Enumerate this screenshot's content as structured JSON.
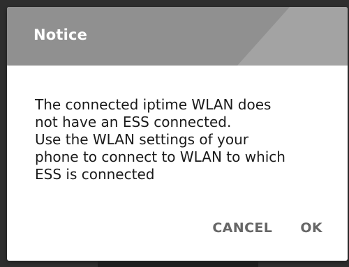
{
  "dialog": {
    "title": "Notice",
    "message": "The connected iptime WLAN does\nnot have an ESS connected.\n Use the WLAN settings of your\nphone to connect to WLAN to which\nESS is connected",
    "actions": {
      "cancel_label": "CANCEL",
      "ok_label": "OK"
    }
  },
  "colors": {
    "header_bg": "#909090",
    "dialog_bg": "#ffffff",
    "button_text": "#666666"
  }
}
